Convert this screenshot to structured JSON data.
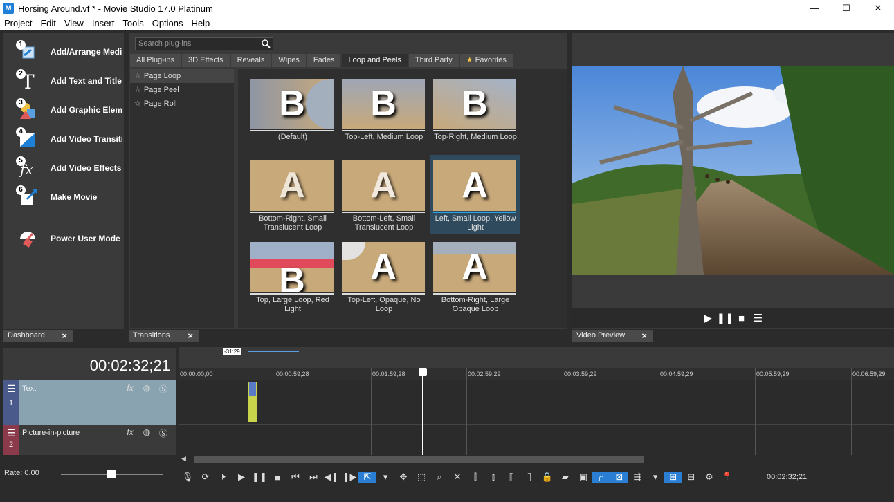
{
  "window": {
    "title": "Horsing Around.vf * - Movie Studio 17.0 Platinum",
    "app_icon": "M",
    "minimize": "—",
    "maximize": "☐",
    "close": "✕"
  },
  "menu": [
    "Project",
    "Edit",
    "View",
    "Insert",
    "Tools",
    "Options",
    "Help"
  ],
  "dashboard": {
    "items": [
      {
        "num": "1",
        "label": "Add/Arrange Media"
      },
      {
        "num": "2",
        "label": "Add Text and Titles"
      },
      {
        "num": "3",
        "label": "Add Graphic Elements"
      },
      {
        "num": "4",
        "label": "Add Video Transitions"
      },
      {
        "num": "5",
        "label": "Add Video Effects"
      },
      {
        "num": "6",
        "label": "Make Movie"
      }
    ],
    "power_user": "Power User Mode",
    "tab": "Dashboard"
  },
  "transitions": {
    "search_placeholder": "Search plug-ins",
    "tabs": [
      "All Plug-ins",
      "3D Effects",
      "Reveals",
      "Wipes",
      "Fades",
      "Loop and Peels",
      "Third Party",
      "Favorites"
    ],
    "active_tab": "Loop and Peels",
    "tree": [
      "Page Loop",
      "Page Peel",
      "Page Roll"
    ],
    "presets": [
      {
        "label": "(Default)",
        "letter": "B"
      },
      {
        "label": "Top-Left, Medium Loop",
        "letter": "B"
      },
      {
        "label": "Top-Right, Medium Loop",
        "letter": "B"
      },
      {
        "label": "Bottom-Right, Small Translucent Loop",
        "letter": "A"
      },
      {
        "label": "Bottom-Left, Small Translucent Loop",
        "letter": "A"
      },
      {
        "label": "Left, Small Loop, Yellow Light",
        "letter": "A"
      },
      {
        "label": "Top, Large Loop, Red Light",
        "letter": "B"
      },
      {
        "label": "Top-Left, Opaque, No Loop",
        "letter": "A"
      },
      {
        "label": "Bottom-Right, Large Opaque Loop",
        "letter": "A"
      }
    ],
    "tab": "Transitions"
  },
  "preview": {
    "tab": "Video Preview"
  },
  "timeline": {
    "timecode": "00:02:32;21",
    "flag": "-31:29",
    "ticks": [
      "00:00:00;00",
      "00:00:59;28",
      "00:01:59;28",
      "00:02:59;29",
      "00:03:59;29",
      "00:04:59;29",
      "00:05:59;29",
      "00:06:59;29"
    ],
    "tracks": [
      {
        "num": "1",
        "name": "Text"
      },
      {
        "num": "2",
        "name": "Picture-in-picture"
      }
    ],
    "rate": "Rate: 0.00",
    "end_timecode": "00:02:32;21"
  }
}
